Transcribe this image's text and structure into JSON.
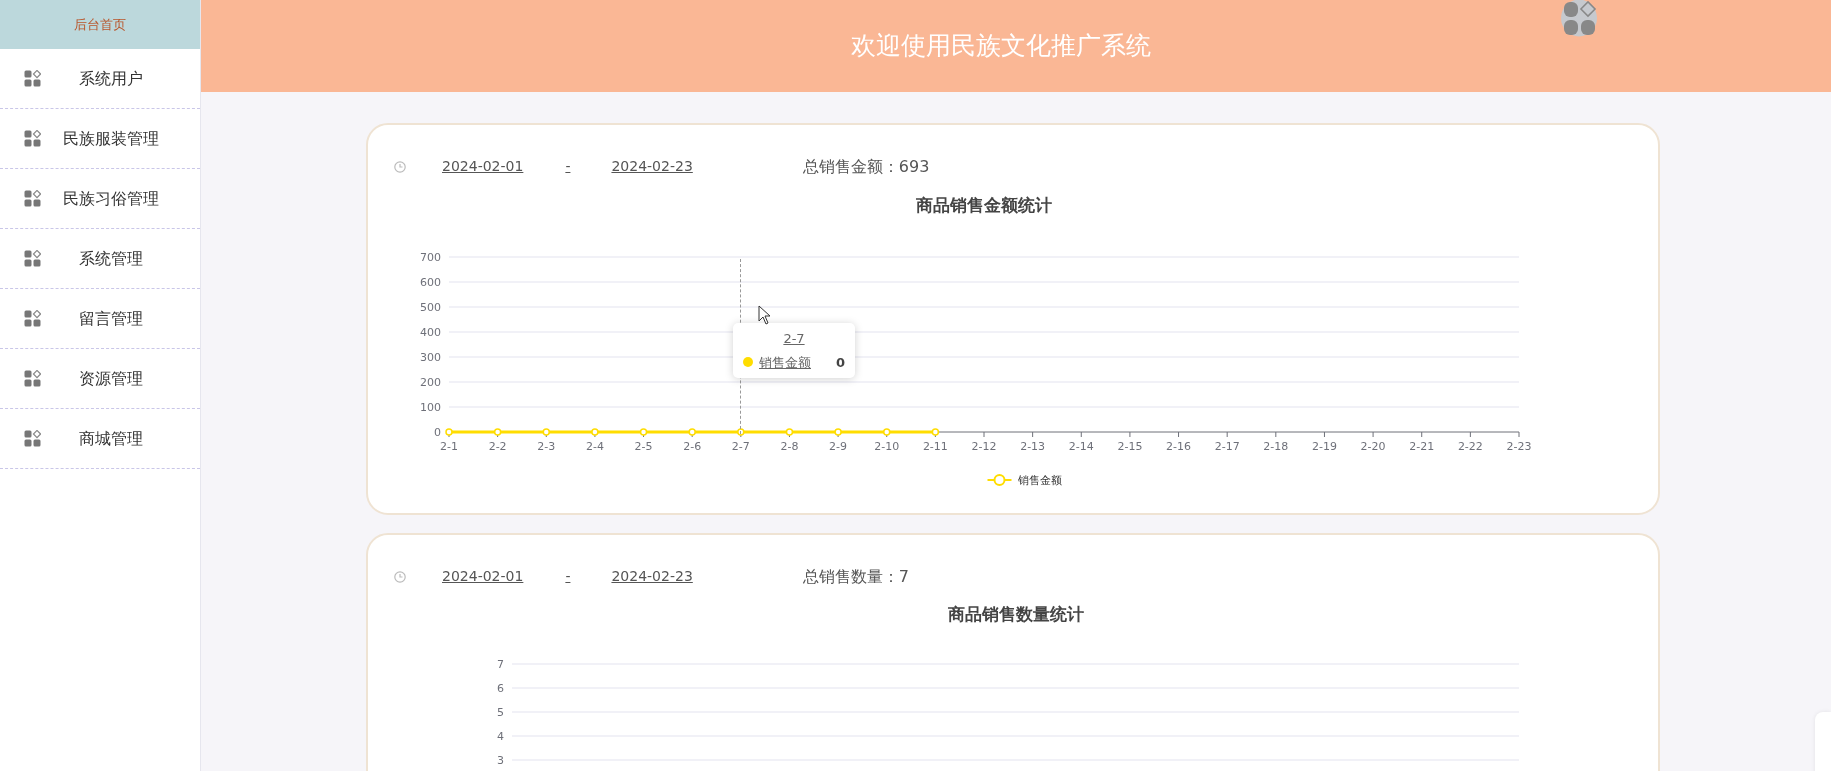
{
  "sidebar": {
    "home": "后台首页",
    "items": [
      {
        "label": "系统用户"
      },
      {
        "label": "民族服装管理"
      },
      {
        "label": "民族习俗管理"
      },
      {
        "label": "系统管理"
      },
      {
        "label": "留言管理"
      },
      {
        "label": "资源管理"
      },
      {
        "label": "商城管理"
      }
    ]
  },
  "header": {
    "title": "欢迎使用民族文化推广系统"
  },
  "cards": [
    {
      "start_date": "2024-02-01",
      "separator": "-",
      "end_date": "2024-02-23",
      "total": "总销售金额：693",
      "chart_data": {
        "type": "line",
        "title": "商品销售金额统计",
        "categories": [
          "2-1",
          "2-2",
          "2-3",
          "2-4",
          "2-5",
          "2-6",
          "2-7",
          "2-8",
          "2-9",
          "2-10",
          "2-11",
          "2-12",
          "2-13",
          "2-14",
          "2-15",
          "2-16",
          "2-17",
          "2-18",
          "2-19",
          "2-20",
          "2-21",
          "2-22",
          "2-23"
        ],
        "series": [
          {
            "name": "销售金额",
            "color": "#ffdd00",
            "values": [
              0,
              0,
              0,
              0,
              0,
              0,
              0,
              0,
              0,
              0,
              0,
              null,
              null,
              null,
              null,
              null,
              null,
              null,
              null,
              null,
              null,
              null,
              null
            ]
          }
        ],
        "ylim": [
          0,
          700
        ],
        "yticks": [
          0,
          100,
          200,
          300,
          400,
          500,
          600,
          700
        ],
        "grid": true,
        "marker": true
      },
      "tooltip": {
        "title": "2-7",
        "series": "销售金额",
        "value": "0"
      }
    },
    {
      "start_date": "2024-02-01",
      "separator": "-",
      "end_date": "2024-02-23",
      "total": "总销售数量：7",
      "chart": {
        "title": "商品销售数量统计",
        "axis_labels": [
          "7",
          "6",
          "5",
          "4",
          "3"
        ]
      }
    }
  ]
}
